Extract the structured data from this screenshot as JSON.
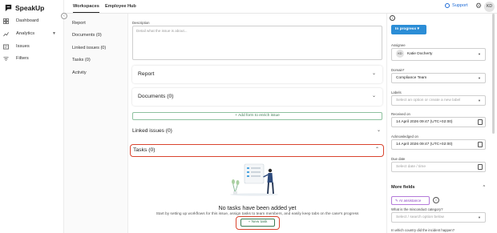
{
  "app": {
    "logo_text": "SpeakUp"
  },
  "leftnav": {
    "items": [
      {
        "label": "Dashboard",
        "icon": "dashboard-icon"
      },
      {
        "label": "Analytics",
        "icon": "analytics-icon"
      },
      {
        "label": "Issues",
        "icon": "issues-icon"
      },
      {
        "label": "Filters",
        "icon": "filters-icon"
      }
    ]
  },
  "topbar": {
    "tabs": [
      {
        "label": "Workspaces"
      },
      {
        "label": "Employee Hub"
      }
    ],
    "support_label": "Support",
    "avatar_initials": "KD"
  },
  "submenu": {
    "items": [
      {
        "label": "Report"
      },
      {
        "label": "Documents (0)"
      },
      {
        "label": "Linked issues (0)"
      },
      {
        "label": "Tasks (0)"
      },
      {
        "label": "Activity"
      }
    ]
  },
  "main": {
    "description_label": "Description",
    "description_placeholder": "Detail what the issue is about...",
    "report_title": "Report",
    "documents_title": "Documents (0)",
    "add_form_label": "+   Add form to enrich issue",
    "linked_title": "Linked issues (0)",
    "tasks_title": "Tasks (0)",
    "empty_title": "No tasks have been added yet",
    "empty_desc": "Start by setting up workflows for this issue, assign tasks to team members, and easily keep tabs on the case's progress",
    "new_task_label": "+   New task"
  },
  "right": {
    "status_label": "In progress  ▾",
    "assignee_label": "Assignee",
    "assignee_initials": "KD",
    "assignee_name": "Katie Docherty",
    "domain_label": "Domain*",
    "domain_value": "Compliance Team",
    "labels_label": "Labels",
    "labels_placeholder": "Select an option or create a new label",
    "received_label": "Received on",
    "received_value": "14 April 2026 09:47 (UTC+02:00)",
    "ack_label": "Acknowledged on",
    "ack_value": "14 April 2026 09:47 (UTC+02:00)",
    "due_label": "Due date",
    "due_placeholder": "Select date / time",
    "more_fields_label": "More fields",
    "ai_label": "AI assistance",
    "category_label": "What is the misconduct category?",
    "category_placeholder": "Select / search option below",
    "country_label": "In which country did the incident happen?"
  },
  "colors": {
    "accent": "#2b8dd6",
    "highlight": "#d9442e",
    "green": "#3d7d55",
    "ai": "#8a3fc2"
  }
}
